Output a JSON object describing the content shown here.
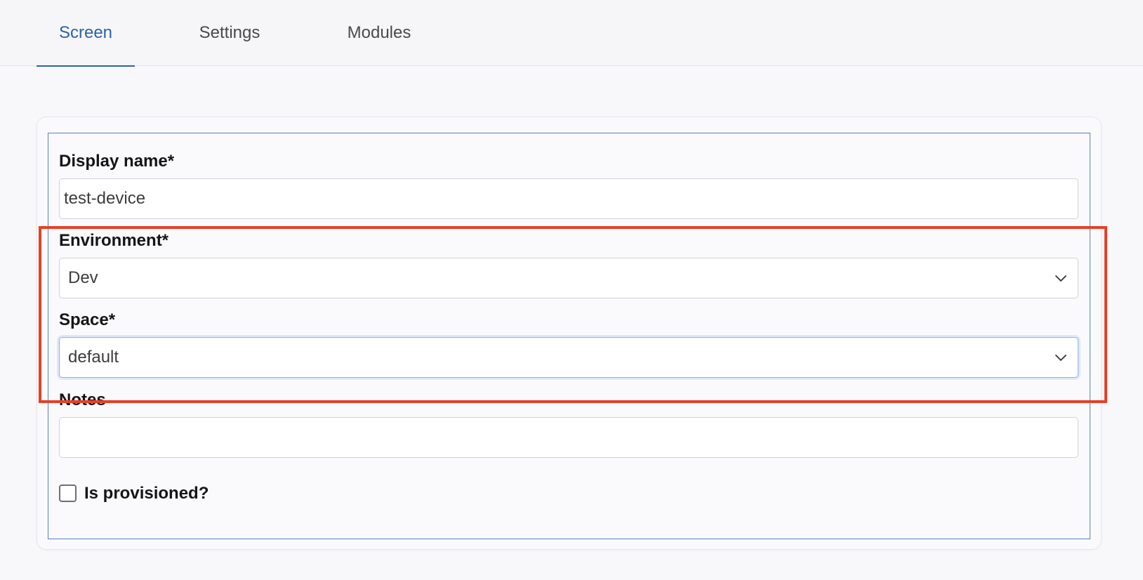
{
  "tabs": [
    {
      "label": "Screen",
      "active": true
    },
    {
      "label": "Settings",
      "active": false
    },
    {
      "label": "Modules",
      "active": false
    }
  ],
  "form": {
    "display_name": {
      "label": "Display name*",
      "value": "test-device"
    },
    "environment": {
      "label": "Environment*",
      "selected": "Dev"
    },
    "space": {
      "label": "Space*",
      "selected": "default"
    },
    "notes": {
      "label": "Notes",
      "value": ""
    },
    "is_provisioned": {
      "label": "Is provisioned?",
      "checked": false
    }
  },
  "colors": {
    "accent": "#2d62a8",
    "highlight": "#e64027"
  },
  "icons": {
    "select_chevron": "chevron-down-icon"
  }
}
